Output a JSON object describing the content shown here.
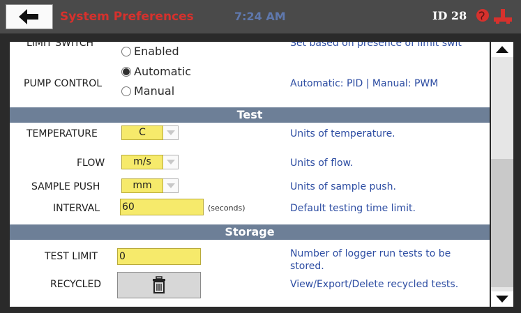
{
  "header": {
    "title": "System Preferences",
    "time": "7:24 AM",
    "device_id": "ID 28"
  },
  "rows": {
    "limit_switch": {
      "label": "LIMIT SWITCH",
      "option": "Enabled",
      "description": "Set based on presence of limit swit"
    },
    "pump_control": {
      "label": "PUMP CONTROL",
      "option_1": "Automatic",
      "option_2": "Manual",
      "selected": "Automatic",
      "description": "Automatic: PID | Manual: PWM"
    },
    "temperature": {
      "label": "TEMPERATURE",
      "value": "C",
      "description": "Units of temperature."
    },
    "flow": {
      "label": "FLOW",
      "value": "m/s",
      "description": "Units of flow."
    },
    "sample_push": {
      "label": "SAMPLE PUSH",
      "value": "mm",
      "description": "Units of sample push."
    },
    "interval": {
      "label": "INTERVAL",
      "value": "60",
      "unit": "(seconds)",
      "description": "Default testing time limit."
    },
    "test_limit": {
      "label": "TEST LIMIT",
      "value": "0",
      "description_1": "Number of logger run tests to be",
      "description_2": "stored."
    },
    "recycled": {
      "label": "RECYCLED",
      "description": "View/Export/Delete recycled tests."
    }
  },
  "sections": {
    "test": "Test",
    "storage": "Storage"
  },
  "icons": {
    "back": "back-arrow-icon",
    "globe": "globe-status-icon",
    "connection": "connection-status-icon",
    "trash": "trash-icon"
  },
  "colors": {
    "title_red": "#d6312d",
    "time_blue": "#5f78ad",
    "field_yellow": "#f6ea6b",
    "section_bar": "#6d7f97",
    "description_blue": "#2c4ca2"
  }
}
